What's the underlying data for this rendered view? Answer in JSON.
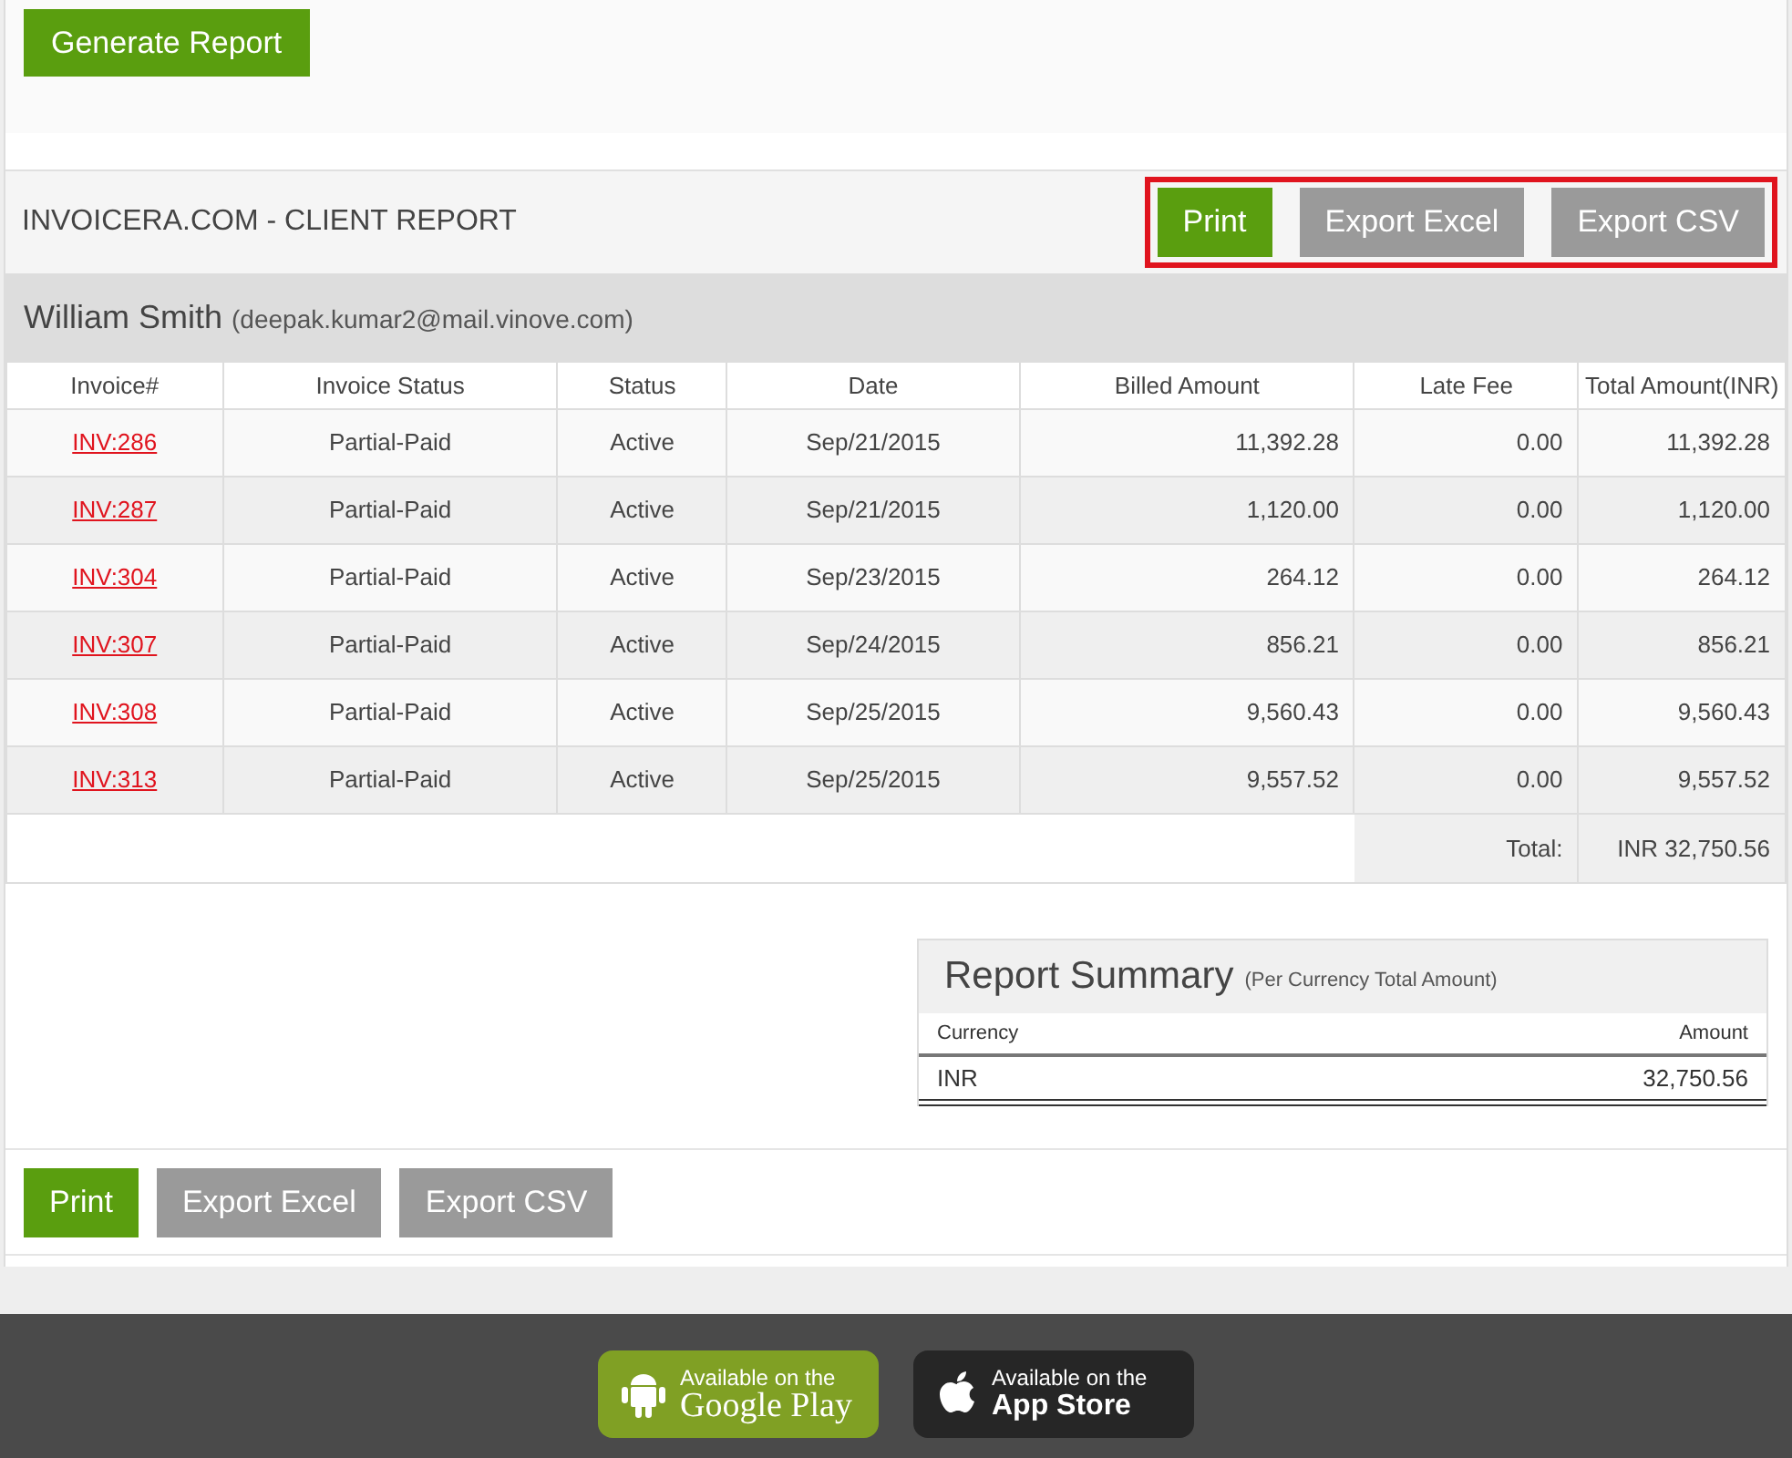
{
  "generate_button": {
    "label": "Generate Report"
  },
  "report": {
    "title": "INVOICERA.COM - CLIENT REPORT",
    "actions": [
      {
        "label": "Print",
        "kind": "primary"
      },
      {
        "label": "Export Excel",
        "kind": "secondary"
      },
      {
        "label": "Export CSV",
        "kind": "secondary"
      }
    ],
    "client": {
      "name": "William Smith",
      "email": "(deepak.kumar2@mail.vinove.com)"
    },
    "table": {
      "columns": [
        "Invoice#",
        "Invoice Status",
        "Status",
        "Date",
        "Billed Amount",
        "Late Fee",
        "Total Amount(INR)"
      ],
      "rows": [
        [
          "INV:286",
          "Partial-Paid",
          "Active",
          "Sep/21/2015",
          "11,392.28",
          "0.00",
          "11,392.28"
        ],
        [
          "INV:287",
          "Partial-Paid",
          "Active",
          "Sep/21/2015",
          "1,120.00",
          "0.00",
          "1,120.00"
        ],
        [
          "INV:304",
          "Partial-Paid",
          "Active",
          "Sep/23/2015",
          "264.12",
          "0.00",
          "264.12"
        ],
        [
          "INV:307",
          "Partial-Paid",
          "Active",
          "Sep/24/2015",
          "856.21",
          "0.00",
          "856.21"
        ],
        [
          "INV:308",
          "Partial-Paid",
          "Active",
          "Sep/25/2015",
          "9,560.43",
          "0.00",
          "9,560.43"
        ],
        [
          "INV:313",
          "Partial-Paid",
          "Active",
          "Sep/25/2015",
          "9,557.52",
          "0.00",
          "9,557.52"
        ]
      ],
      "total_label": "Total:",
      "total_value": "INR 32,750.56"
    },
    "summary": {
      "title": "Report Summary",
      "subtitle": "(Per Currency Total Amount)",
      "columns": [
        "Currency",
        "Amount"
      ],
      "rows": [
        [
          "INR",
          "32,750.56"
        ]
      ]
    },
    "bottom_actions": [
      {
        "label": "Print",
        "kind": "primary"
      },
      {
        "label": "Export Excel",
        "kind": "secondary"
      },
      {
        "label": "Export CSV",
        "kind": "secondary"
      }
    ]
  },
  "footer": {
    "badges": [
      {
        "kind": "android",
        "line1": "Available on the",
        "line2": "Google Play"
      },
      {
        "kind": "apple",
        "line1": "Available on the",
        "line2": "App Store"
      }
    ]
  }
}
